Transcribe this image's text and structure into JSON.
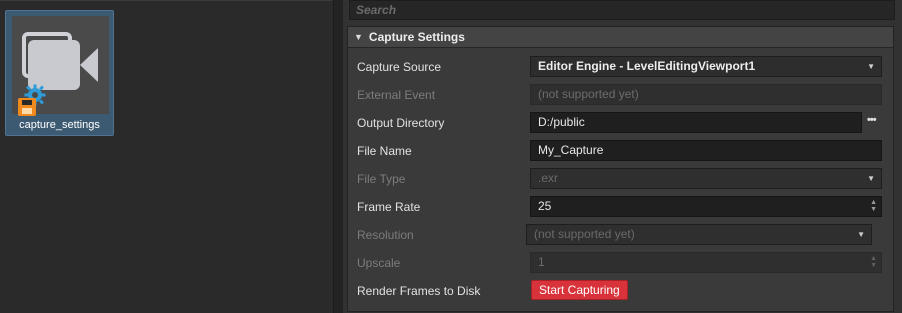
{
  "asset": {
    "label": "capture_settings",
    "icon": "camera-icon",
    "badge_icons": [
      "gear-icon",
      "floppy-disk-icon"
    ]
  },
  "search": {
    "placeholder": "Search"
  },
  "section": {
    "title": "Capture Settings",
    "expanded": true
  },
  "properties": {
    "capture_source": {
      "label": "Capture Source",
      "value": "Editor Engine - LevelEditingViewport1"
    },
    "external_event": {
      "label": "External Event",
      "value": "(not supported yet)"
    },
    "output_directory": {
      "label": "Output Directory",
      "value": "D:/public",
      "browse": "•••"
    },
    "file_name": {
      "label": "File Name",
      "value": "My_Capture"
    },
    "file_type": {
      "label": "File Type",
      "value": ".exr"
    },
    "frame_rate": {
      "label": "Frame Rate",
      "value": "25"
    },
    "resolution": {
      "label": "Resolution",
      "value": "(not supported yet)"
    },
    "upscale": {
      "label": "Upscale",
      "value": "1"
    },
    "render_frames": {
      "label": "Render Frames to Disk",
      "button": "Start Capturing"
    }
  },
  "colors": {
    "accent_selection": "#3d5a73",
    "start_button": "#d8333a",
    "disk_badge": "#f08a1c"
  }
}
